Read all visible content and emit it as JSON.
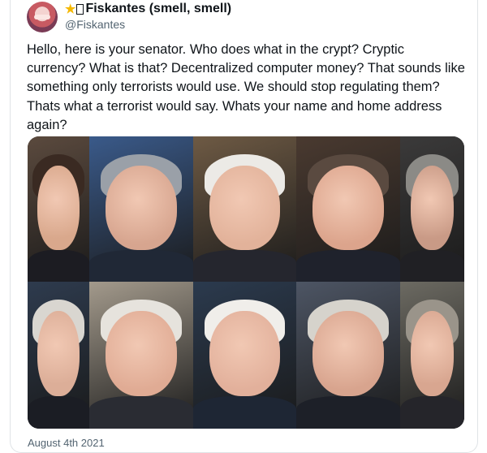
{
  "tweet": {
    "display_name": "Fiskantes (smell, smell)",
    "handle": "@Fiskantes",
    "text": "Hello, here is your senator. Who does what in the crypt? Cryptic currency? What is that? Decentralized computer money?  That sounds like something only terrorists would use. We should stop regulating them? Thats what a terrorist would say. Whats your name and home address again?",
    "date": "August 4th 2021"
  },
  "photos": [
    {
      "name": "portrait-1",
      "bg": "#5b4a3e",
      "skin": "#d9a88c",
      "hair": "#3a2a22",
      "suit": "#1c1c22"
    },
    {
      "name": "portrait-2",
      "bg": "#3a5a8a",
      "skin": "#d7a58f",
      "hair": "#9aa0a8",
      "suit": "#202836"
    },
    {
      "name": "portrait-3",
      "bg": "#6e5a44",
      "skin": "#e2b29a",
      "hair": "#eceae6",
      "suit": "#25262e"
    },
    {
      "name": "portrait-4",
      "bg": "#4a3a30",
      "skin": "#dca48c",
      "hair": "#5a4a40",
      "suit": "#1f222c"
    },
    {
      "name": "portrait-5",
      "bg": "#3b3a3a",
      "skin": "#c99a86",
      "hair": "#8b8a86",
      "suit": "#202024"
    },
    {
      "name": "portrait-6",
      "bg": "#2e3b4e",
      "skin": "#dcae98",
      "hair": "#d9d6d0",
      "suit": "#1b1d24"
    },
    {
      "name": "portrait-7",
      "bg": "#a39a8c",
      "skin": "#e0ab94",
      "hair": "#e6e3dd",
      "suit": "#2a2c33"
    },
    {
      "name": "portrait-8",
      "bg": "#2b3a4e",
      "skin": "#e2b09b",
      "hair": "#f0eeea",
      "suit": "#1e2634"
    },
    {
      "name": "portrait-9",
      "bg": "#4d5564",
      "skin": "#d8a48e",
      "hair": "#d6d3cc",
      "suit": "#1d2028"
    },
    {
      "name": "portrait-10",
      "bg": "#6c6a62",
      "skin": "#d8a690",
      "hair": "#9a948a",
      "suit": "#25252a"
    }
  ]
}
